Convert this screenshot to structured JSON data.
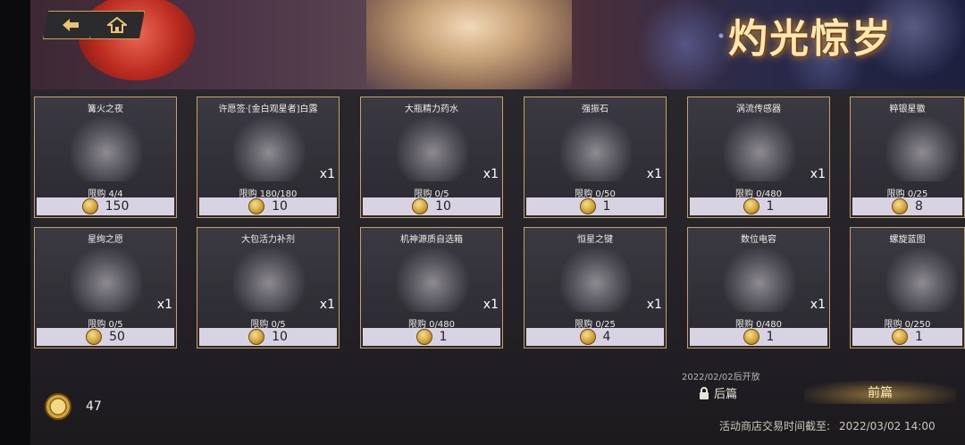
{
  "header": {
    "logo_text": "灼光惊岁"
  },
  "nav": {
    "back_icon": "back-arrow-icon",
    "home_icon": "home-icon"
  },
  "currency": {
    "balance": "47",
    "icon": "coin-icon"
  },
  "items": [
    {
      "name": "篝火之夜",
      "qty": "",
      "limit": "限购 4/4",
      "price": "150",
      "icon": "skin-portrait-icon"
    },
    {
      "name": "许愿签·[金白观星者]白露",
      "qty": "x1",
      "limit": "限购 180/180",
      "price": "10",
      "icon": "wish-card-icon"
    },
    {
      "name": "大瓶精力药水",
      "qty": "x1",
      "limit": "限购 0/5",
      "price": "10",
      "icon": "bottle-icon"
    },
    {
      "name": "强振石",
      "qty": "x1",
      "limit": "限购 0/50",
      "price": "1",
      "icon": "stone-icon"
    },
    {
      "name": "涡流传感器",
      "qty": "x1",
      "limit": "限购 0/480",
      "price": "1",
      "icon": "sensor-icon"
    },
    {
      "name": "粹银星徽",
      "qty": "",
      "limit": "限购 0/25",
      "price": "8",
      "icon": "star-badge-icon"
    },
    {
      "name": "星绚之愿",
      "qty": "x1",
      "limit": "限购 0/5",
      "price": "50",
      "icon": "ticket-icon"
    },
    {
      "name": "大包活力补剂",
      "qty": "x1",
      "limit": "限购 0/5",
      "price": "10",
      "icon": "pouch-icon"
    },
    {
      "name": "机神源质自选箱",
      "qty": "x1",
      "limit": "限购 0/480",
      "price": "1",
      "icon": "box-icon"
    },
    {
      "name": "恒星之键",
      "qty": "x1",
      "limit": "限购 0/25",
      "price": "4",
      "icon": "key-icon"
    },
    {
      "name": "数位电容",
      "qty": "x1",
      "limit": "限购 0/480",
      "price": "1",
      "icon": "capacitor-icon"
    },
    {
      "name": "螺旋蓝图",
      "qty": "",
      "limit": "限购 0/250",
      "price": "1",
      "icon": "blueprint-icon"
    }
  ],
  "footer": {
    "unlock_note": "2022/02/02后开放",
    "next_label": "后篇",
    "prev_label": "前篇",
    "deadline_label": "活动商店交易时间截至:",
    "deadline_value": "2022/03/02 14:00"
  }
}
